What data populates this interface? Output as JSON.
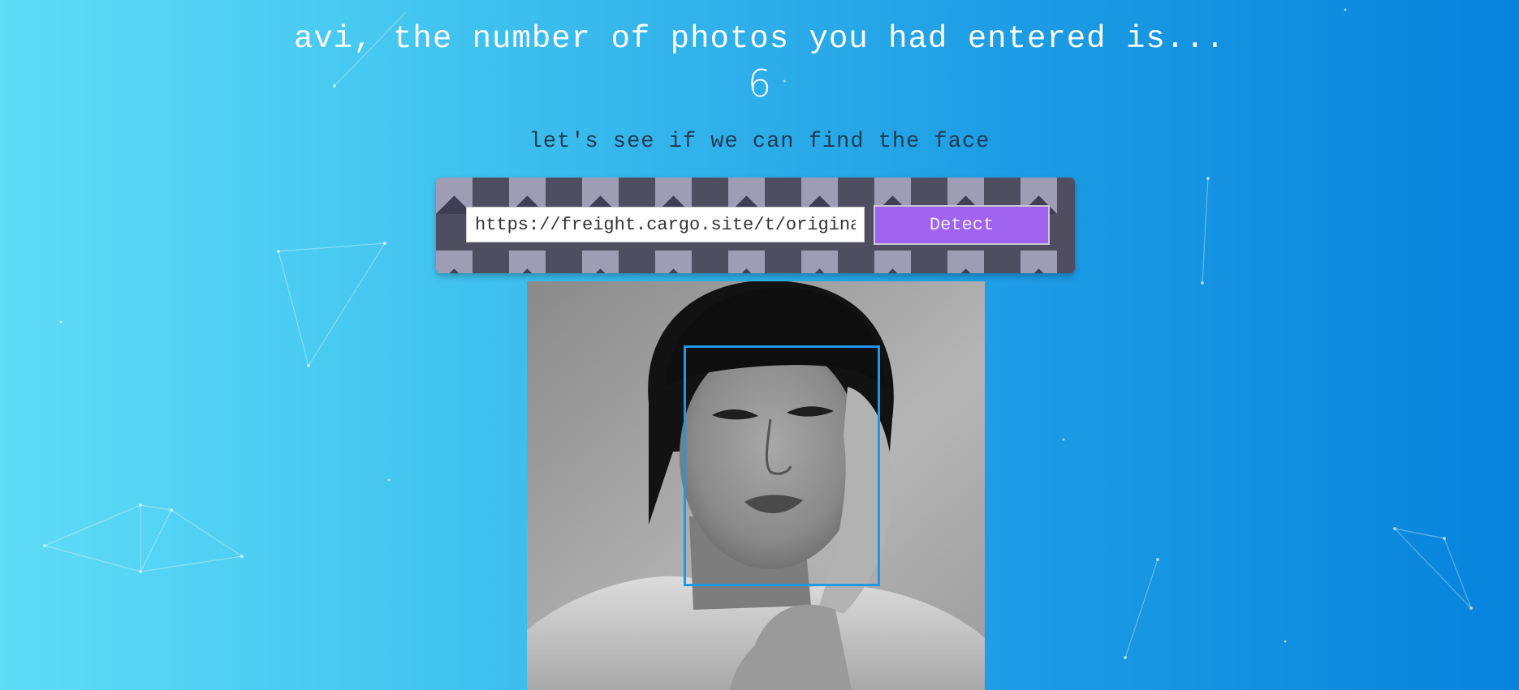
{
  "heading": {
    "text": "avi, the number of photos you had entered is...",
    "count": "6"
  },
  "subheading": "let's see if we can find the face",
  "form": {
    "url_value": "https://freight.cargo.site/t/original",
    "detect_label": "Detect"
  },
  "colors": {
    "background_start": "#5fdcf6",
    "background_end": "#0683dc",
    "button": "#a063f0",
    "face_box": "#1e98e6"
  }
}
